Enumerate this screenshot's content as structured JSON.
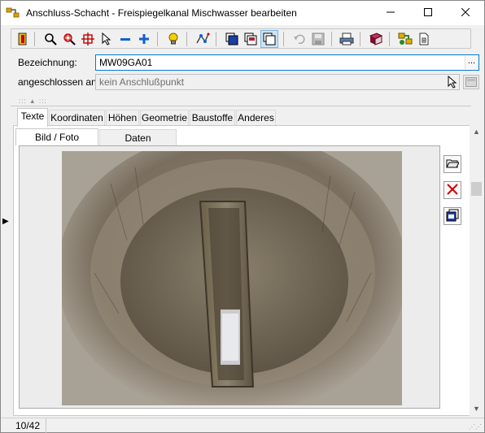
{
  "window": {
    "title": "Anschluss-Schacht - Freispiegelkanal Mischwasser bearbeiten",
    "controls": {
      "minimize": "─",
      "maximize": "☐",
      "close": "✕"
    }
  },
  "toolbar": {
    "buttons": [
      {
        "name": "exit-icon"
      },
      {
        "name": "zoom-icon"
      },
      {
        "name": "zoom-extent-icon"
      },
      {
        "name": "crosshair-icon"
      },
      {
        "name": "pointer-icon"
      },
      {
        "name": "zoom-out-icon"
      },
      {
        "name": "zoom-in-icon"
      },
      {
        "name": "bulb-icon"
      },
      {
        "name": "network-icon"
      },
      {
        "name": "layer-1-icon"
      },
      {
        "name": "layer-2-icon"
      },
      {
        "name": "layer-3-icon"
      },
      {
        "name": "undo-icon"
      },
      {
        "name": "save-icon"
      },
      {
        "name": "print-icon"
      },
      {
        "name": "book-icon"
      },
      {
        "name": "map-icon"
      },
      {
        "name": "document-icon"
      }
    ]
  },
  "form": {
    "bezeichnung_label": "Bezeichnung:",
    "bezeichnung_value": "MW09GA01",
    "bezeichnung_button": "...",
    "angeschlossen_label": "angeschlossen an:",
    "angeschlossen_value": "kein Anschlußpunkt"
  },
  "tabs": [
    "Texte",
    "Koordinaten",
    "Höhen",
    "Geometrie",
    "Baustoffe",
    "Anderes"
  ],
  "active_tab": "Texte",
  "subtabs": [
    "Bild / Foto",
    "Daten"
  ],
  "active_subtab": "Bild / Foto",
  "side_buttons": [
    {
      "name": "open-folder-icon"
    },
    {
      "name": "delete-icon"
    },
    {
      "name": "gallery-icon"
    }
  ],
  "statusbar": {
    "record": "10/42"
  },
  "colors": {
    "accent": "#0078d7",
    "window_bg": "#f0f0f0"
  }
}
